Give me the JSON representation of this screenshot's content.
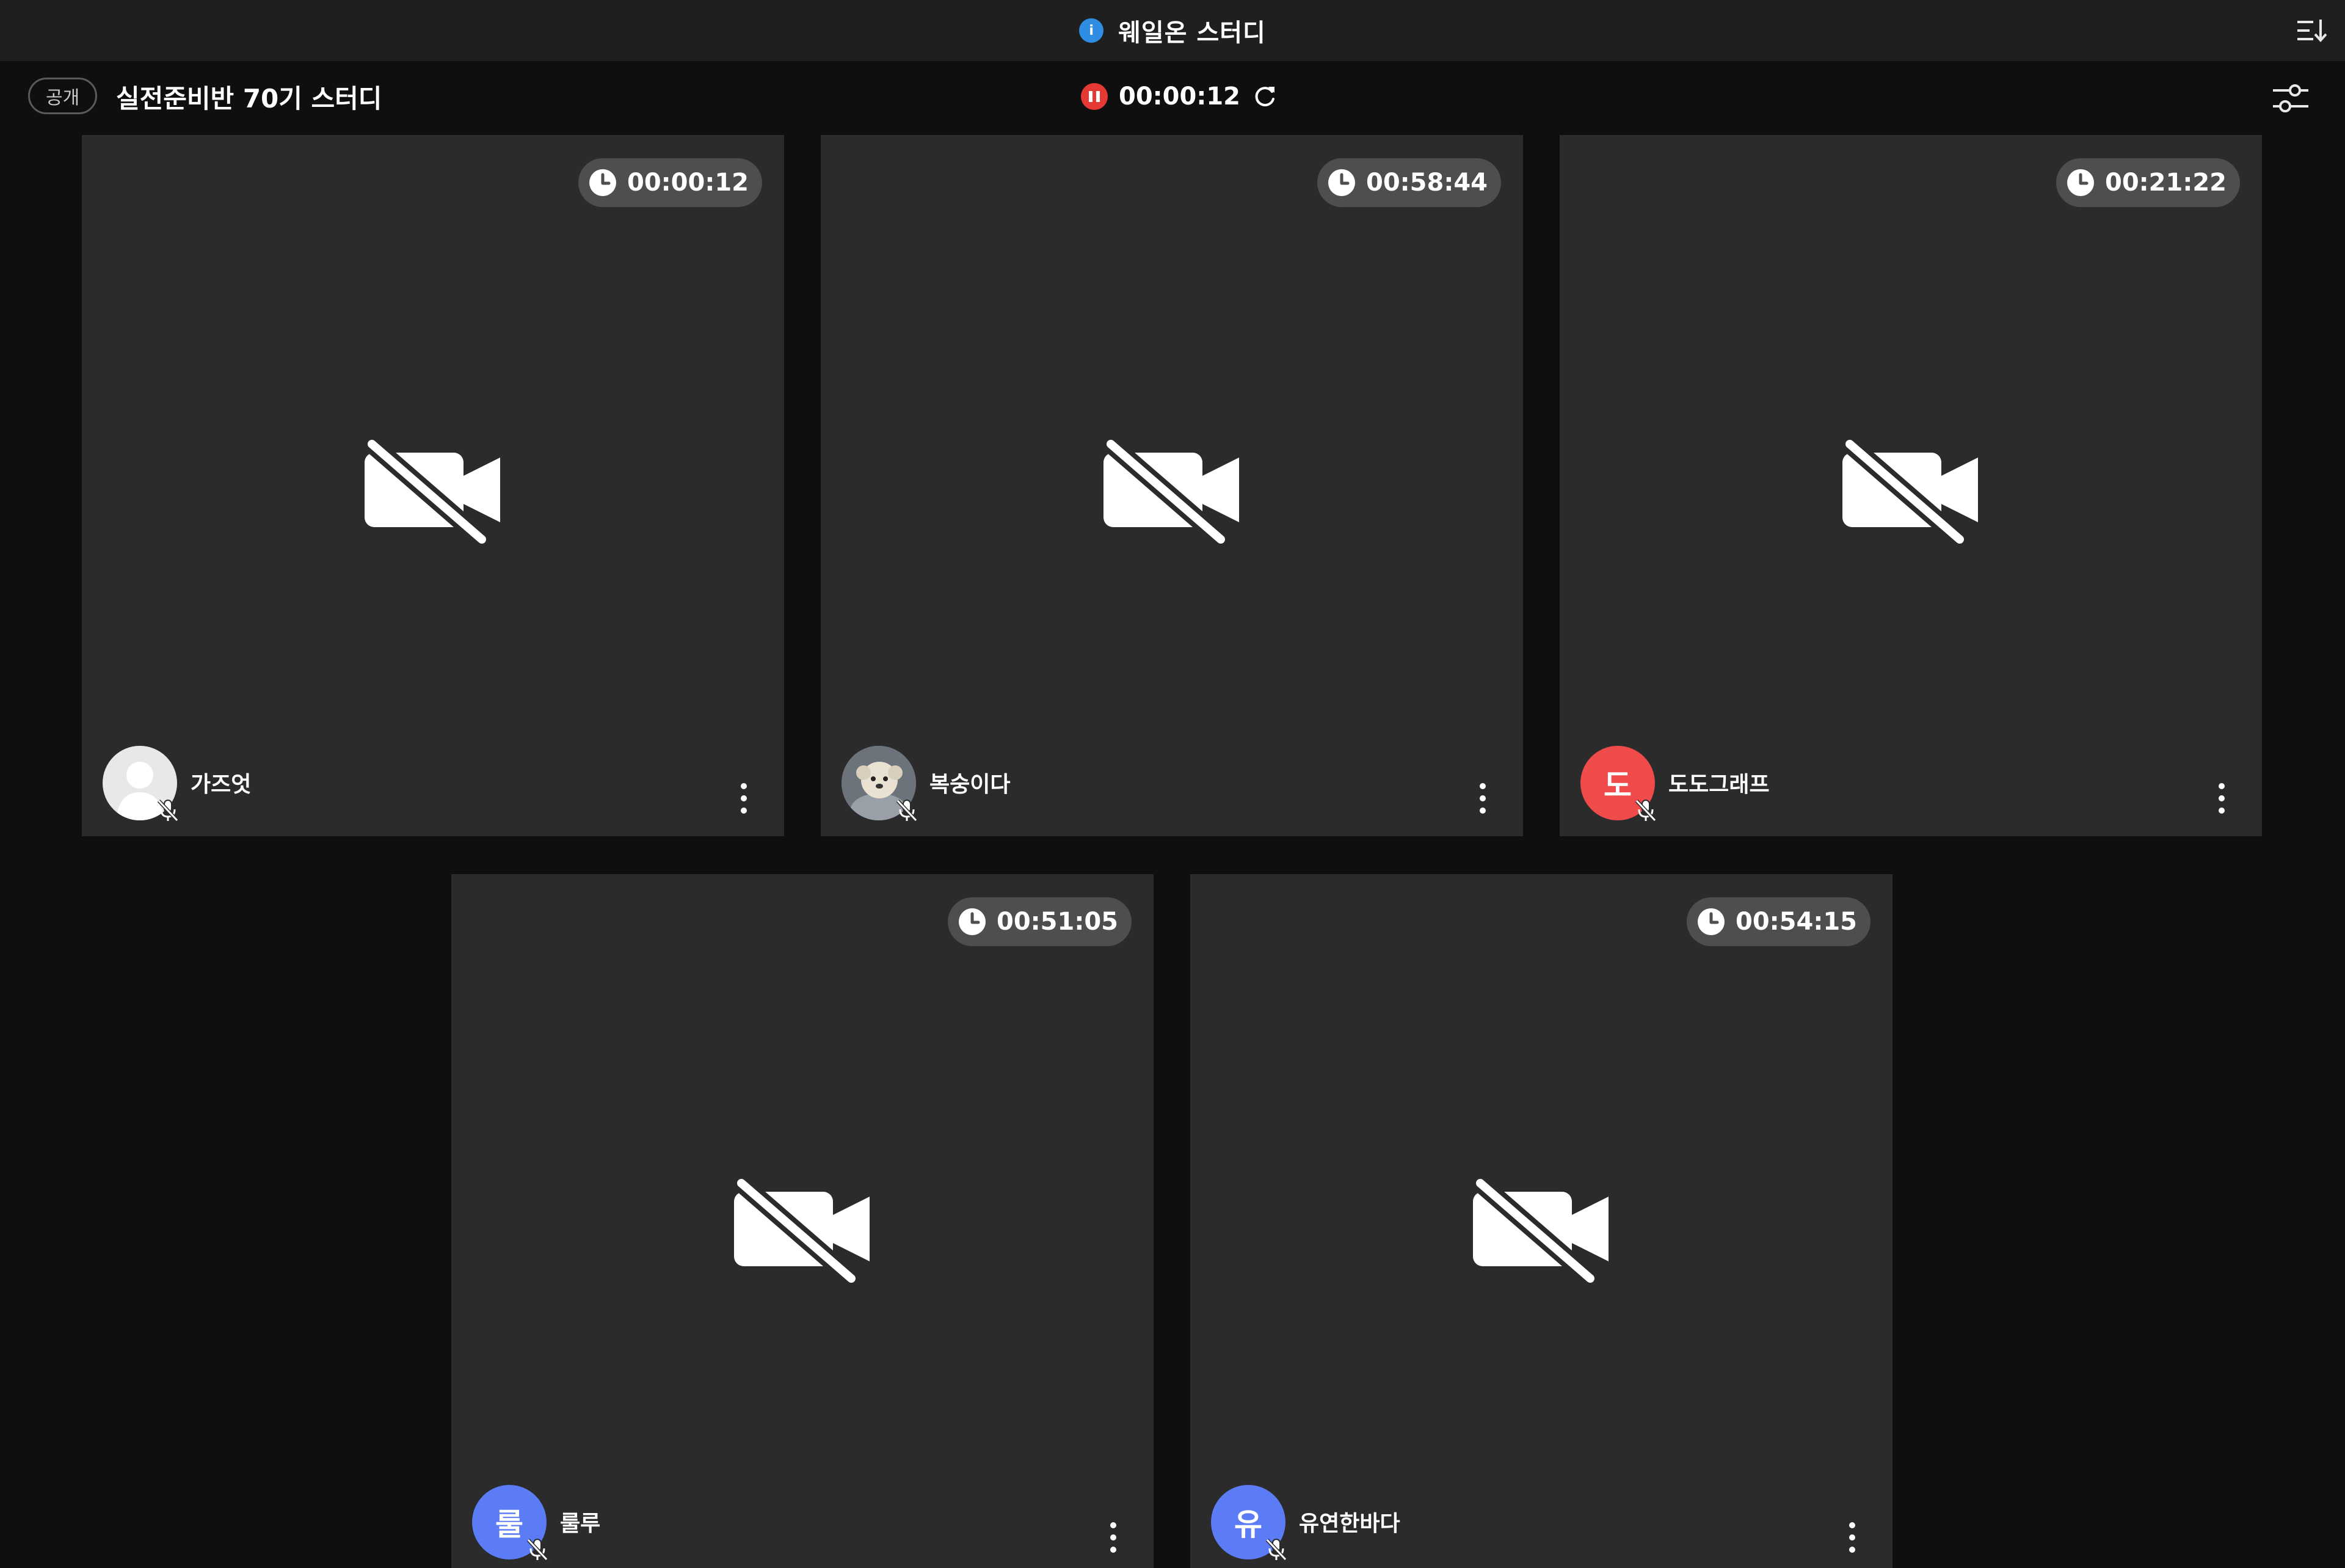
{
  "app": {
    "title": "웨일온 스터디",
    "info_icon": "info-icon",
    "accent": "#2f8de4"
  },
  "room": {
    "visibility_badge": "공개",
    "name": "실전준비반 70기 스터디",
    "recording_time": "00:00:12",
    "recording_color": "#e53935"
  },
  "participants": [
    {
      "name": "가즈엇",
      "timer": "00:00:12",
      "avatar_type": "silhouette",
      "avatar_initial": "",
      "avatar_color": "#e8e8e8",
      "mic": "muted",
      "camera": "off"
    },
    {
      "name": "복숭이다",
      "timer": "00:58:44",
      "avatar_type": "photo",
      "avatar_initial": "",
      "avatar_color": "#7a7f86",
      "mic": "muted",
      "camera": "off"
    },
    {
      "name": "도도그래프",
      "timer": "00:21:22",
      "avatar_type": "initial",
      "avatar_initial": "도",
      "avatar_color": "#ef4b4b",
      "mic": "muted",
      "camera": "off"
    },
    {
      "name": "룰루",
      "timer": "00:51:05",
      "avatar_type": "initial",
      "avatar_initial": "룰",
      "avatar_color": "#5b7cf5",
      "mic": "muted",
      "camera": "off"
    },
    {
      "name": "유연한바다",
      "timer": "00:54:15",
      "avatar_type": "initial",
      "avatar_initial": "유",
      "avatar_color": "#5b7cf5",
      "mic": "muted",
      "camera": "off"
    }
  ]
}
